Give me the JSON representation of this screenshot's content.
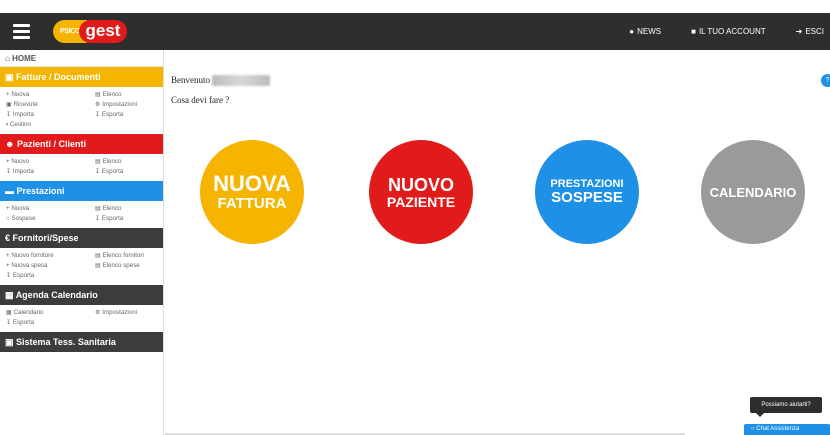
{
  "topbar": {
    "logo_psico": "PSICO",
    "logo_gest": "gest",
    "links": [
      {
        "icon": "bell-icon",
        "glyph": "🔔",
        "label": "NEWS"
      },
      {
        "icon": "user-icon",
        "glyph": "👤",
        "label": "IL TUO ACCOUNT"
      },
      {
        "icon": "sign-out-icon",
        "glyph": "➜",
        "label": "ESCI"
      }
    ]
  },
  "sidebar": {
    "home": "HOME",
    "sections": [
      {
        "title": "Fatture / Documenti",
        "color": "#f5b400",
        "items": [
          "Nuova",
          "Elenco",
          "Ricevute",
          "Impostazioni",
          "Importa",
          "Esporta",
          "Cestino"
        ]
      },
      {
        "title": "Pazienti / Clienti",
        "color": "#e11b1b",
        "items": [
          "Nuovo",
          "Elenco",
          "Importa",
          "Esporta"
        ]
      },
      {
        "title": "Prestazioni",
        "color": "#1e90e6",
        "items": [
          "Nuova",
          "Elenco",
          "Sospese",
          "Esporta"
        ]
      },
      {
        "title": "Fornitori/Spese",
        "color": "#3c3c3c",
        "items": [
          "Nuovo fornitore",
          "Elenco fornitori",
          "Nuova spesa",
          "Elenco spese",
          "Esporta"
        ]
      },
      {
        "title": "Agenda Calendario",
        "color": "#3c3c3c",
        "items": [
          "Calendario",
          "Impostazioni",
          "Esporta"
        ]
      },
      {
        "title": "Sistema Tess. Sanitaria",
        "color": "#3c3c3c",
        "items": []
      }
    ]
  },
  "main": {
    "welcome": "Benvenuto",
    "question": "Cosa devi fare ?",
    "actions": [
      {
        "line1": "NUOVA",
        "line2": "FATTURA",
        "color": "#f5b400"
      },
      {
        "line1": "NUOVO",
        "line2": "PAZIENTE",
        "color": "#e11b1b"
      },
      {
        "line1": "PRESTAZIONI",
        "line2": "SOSPESE",
        "color": "#1e90e6"
      },
      {
        "line1": "CALENDARIO",
        "line2": "",
        "color": "#9a9a9a"
      }
    ]
  },
  "chat": {
    "tooltip": "Possiamo aiutarti?",
    "button": "Chat Assistenza"
  }
}
